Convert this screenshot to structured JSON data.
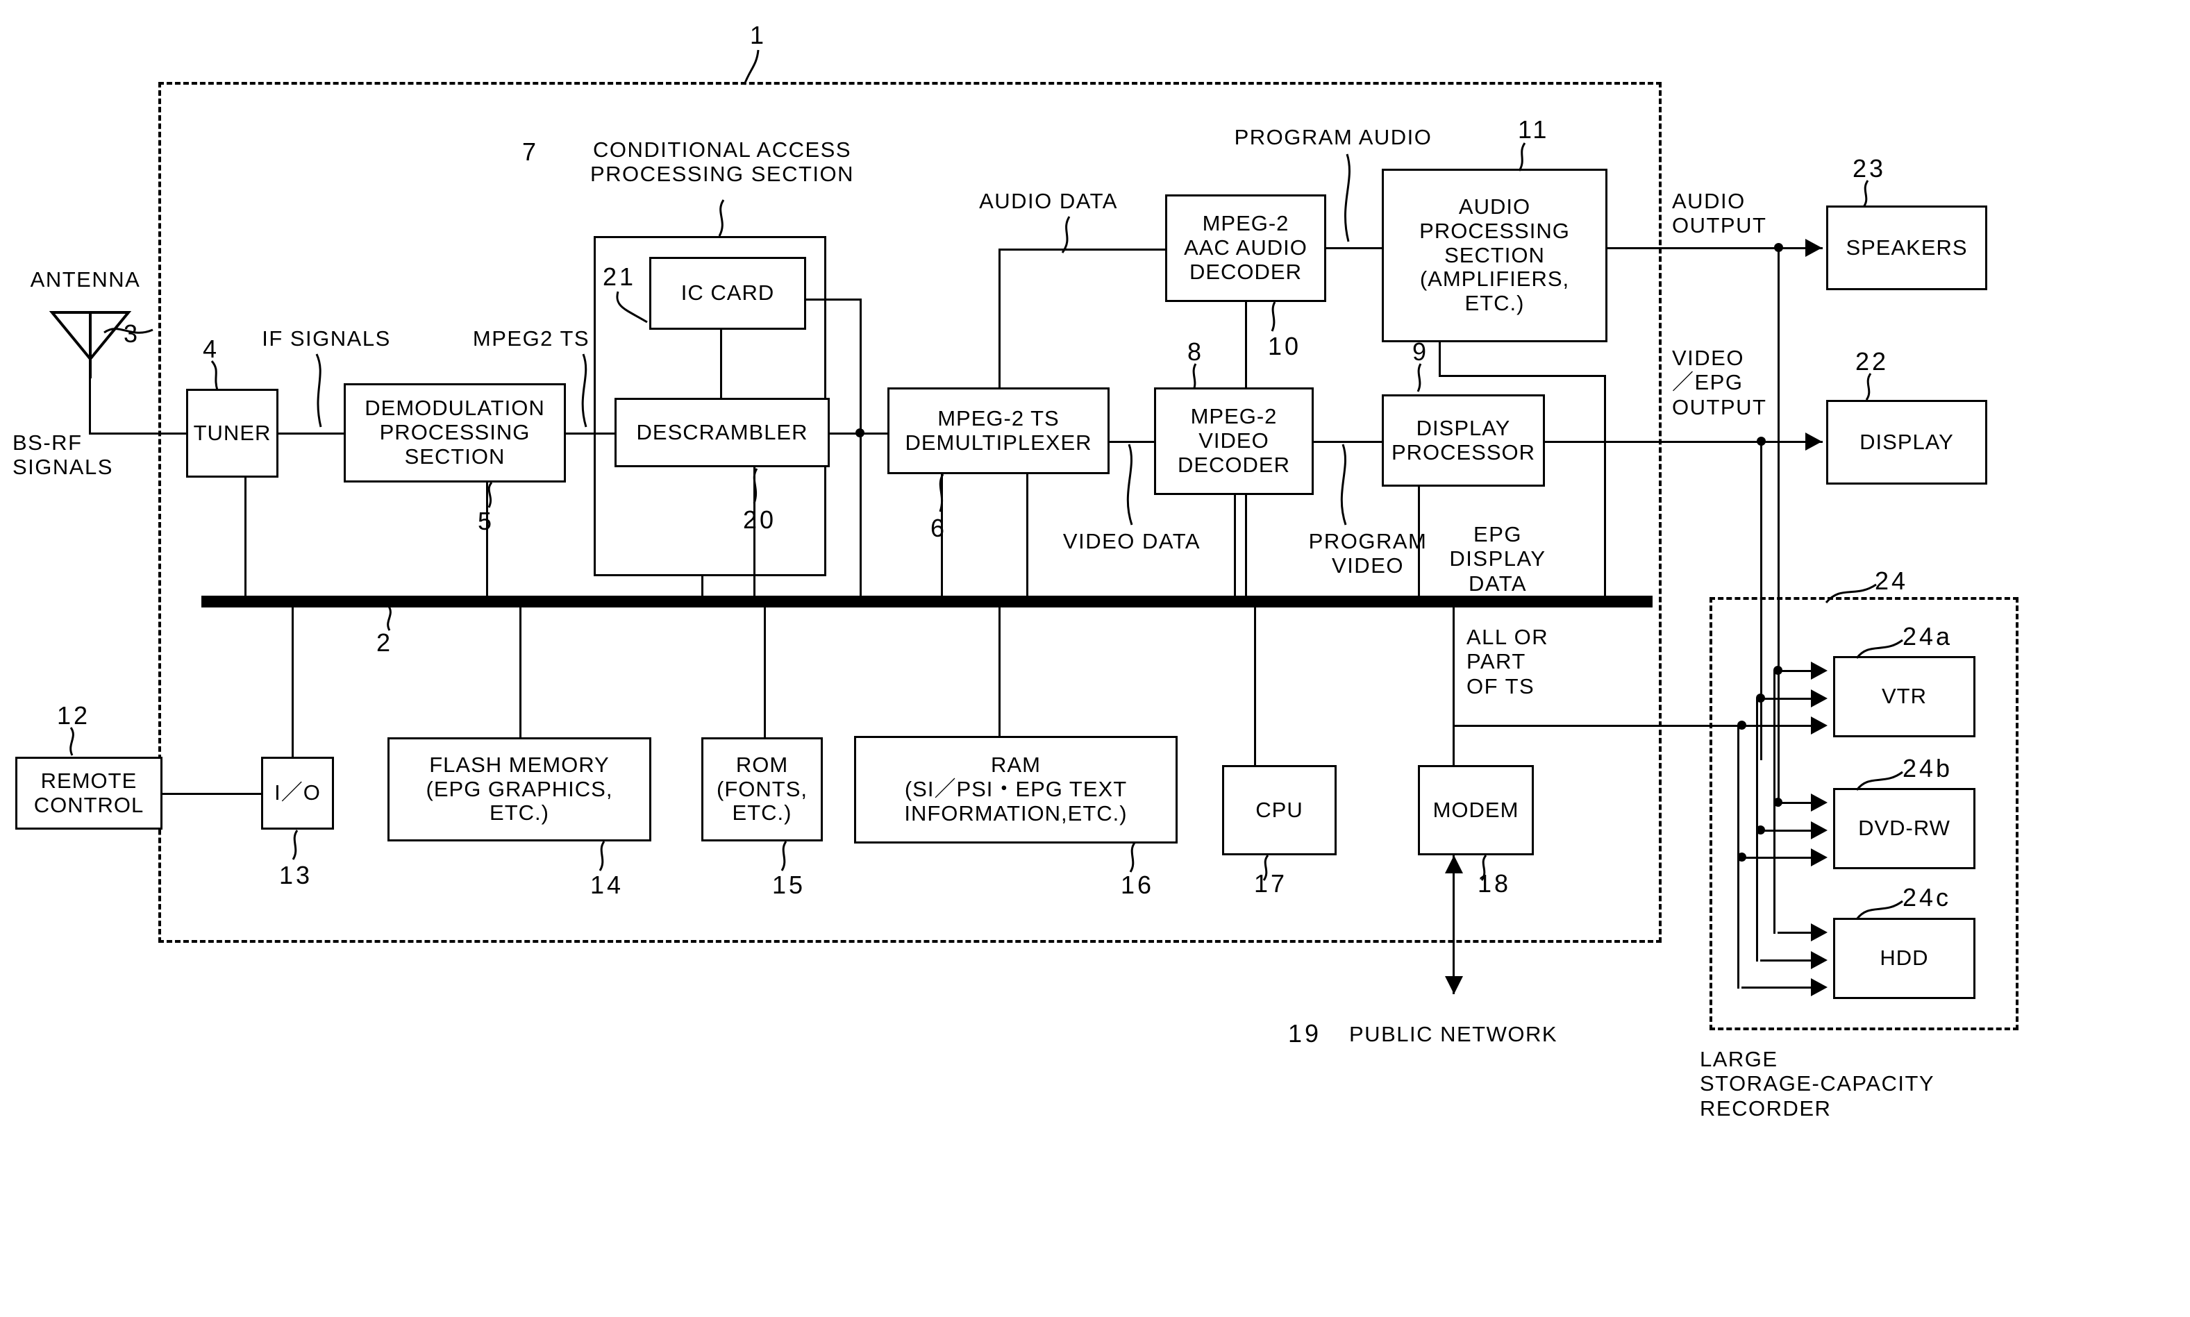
{
  "figure": {
    "top_reference": "1",
    "kind": "patent-block-diagram"
  },
  "blocks": [
    {
      "id": "tuner",
      "label": "TUNER",
      "ref": "4"
    },
    {
      "id": "demod",
      "label": "DEMODULATION\nPROCESSING\nSECTION",
      "ref": "5"
    },
    {
      "id": "ic_card",
      "label": "IC CARD",
      "ref": "21"
    },
    {
      "id": "descrambler",
      "label": "DESCRAMBLER",
      "ref": "20"
    },
    {
      "id": "demux",
      "label": "MPEG-2 TS\nDEMULTIPLEXER",
      "ref": "6"
    },
    {
      "id": "aac",
      "label": "MPEG-2\nAAC AUDIO\nDECODER",
      "ref": "10"
    },
    {
      "id": "video_dec",
      "label": "MPEG-2\nVIDEO\nDECODER",
      "ref": "8"
    },
    {
      "id": "audio_proc",
      "label": "AUDIO\nPROCESSING\nSECTION\n(AMPLIFIERS,\nETC.)",
      "ref": "11"
    },
    {
      "id": "disp_proc",
      "label": "DISPLAY\nPROCESSOR",
      "ref": "9"
    },
    {
      "id": "speakers",
      "label": "SPEAKERS",
      "ref": "23"
    },
    {
      "id": "display",
      "label": "DISPLAY",
      "ref": "22"
    },
    {
      "id": "remote",
      "label": "REMOTE\nCONTROL",
      "ref": "12"
    },
    {
      "id": "io",
      "label": "I／O",
      "ref": "13"
    },
    {
      "id": "flash",
      "label": "FLASH MEMORY\n(EPG GRAPHICS,\nETC.)",
      "ref": "14"
    },
    {
      "id": "rom",
      "label": "ROM\n(FONTS,\nETC.)",
      "ref": "15"
    },
    {
      "id": "ram",
      "label": "RAM\n(SI／PSI・EPG TEXT\nINFORMATION,ETC.)",
      "ref": "16"
    },
    {
      "id": "cpu",
      "label": "CPU",
      "ref": "17"
    },
    {
      "id": "modem",
      "label": "MODEM",
      "ref": "18"
    },
    {
      "id": "vtr",
      "label": "VTR",
      "ref": "24a"
    },
    {
      "id": "dvdrw",
      "label": "DVD-RW",
      "ref": "24b"
    },
    {
      "id": "hdd",
      "label": "HDD",
      "ref": "24c"
    }
  ],
  "groups": [
    {
      "id": "cas",
      "label": "CONDITIONAL ACCESS\nPROCESSING SECTION",
      "ref": "7"
    },
    {
      "id": "recorder",
      "label": "LARGE\nSTORAGE-CAPACITY\nRECORDER",
      "ref": "24"
    }
  ],
  "signal_labels": {
    "antenna": "ANTENNA",
    "bs_rf": "BS-RF\nSIGNALS",
    "if_signals": "IF SIGNALS",
    "mpeg2_ts": "MPEG2 TS",
    "audio_data": "AUDIO DATA",
    "program_audio": "PROGRAM AUDIO",
    "video_data": "VIDEO DATA",
    "program_video": "PROGRAM\nVIDEO",
    "epg_display_data": "EPG\nDISPLAY\nDATA",
    "audio_output": "AUDIO\nOUTPUT",
    "video_epg_output": "VIDEO\n／EPG\nOUTPUT",
    "all_or_part_ts": "ALL OR\nPART\nOF TS",
    "public_network": "PUBLIC NETWORK"
  },
  "refs": {
    "figure": "1",
    "bus": "2",
    "antenna": "3",
    "tuner": "4",
    "demod": "5",
    "demux": "6",
    "cas": "7",
    "video_dec": "8",
    "disp_proc": "9",
    "aac": "10",
    "audio_proc": "11",
    "remote": "12",
    "io": "13",
    "flash": "14",
    "rom": "15",
    "ram": "16",
    "cpu": "17",
    "modem": "18",
    "public_network": "19",
    "descrambler": "20",
    "ic_card": "21",
    "display": "22",
    "speakers": "23",
    "recorder": "24",
    "vtr": "24a",
    "dvdrw": "24b",
    "hdd": "24c"
  },
  "colors": {
    "ink": "#000000",
    "paper": "#ffffff"
  }
}
